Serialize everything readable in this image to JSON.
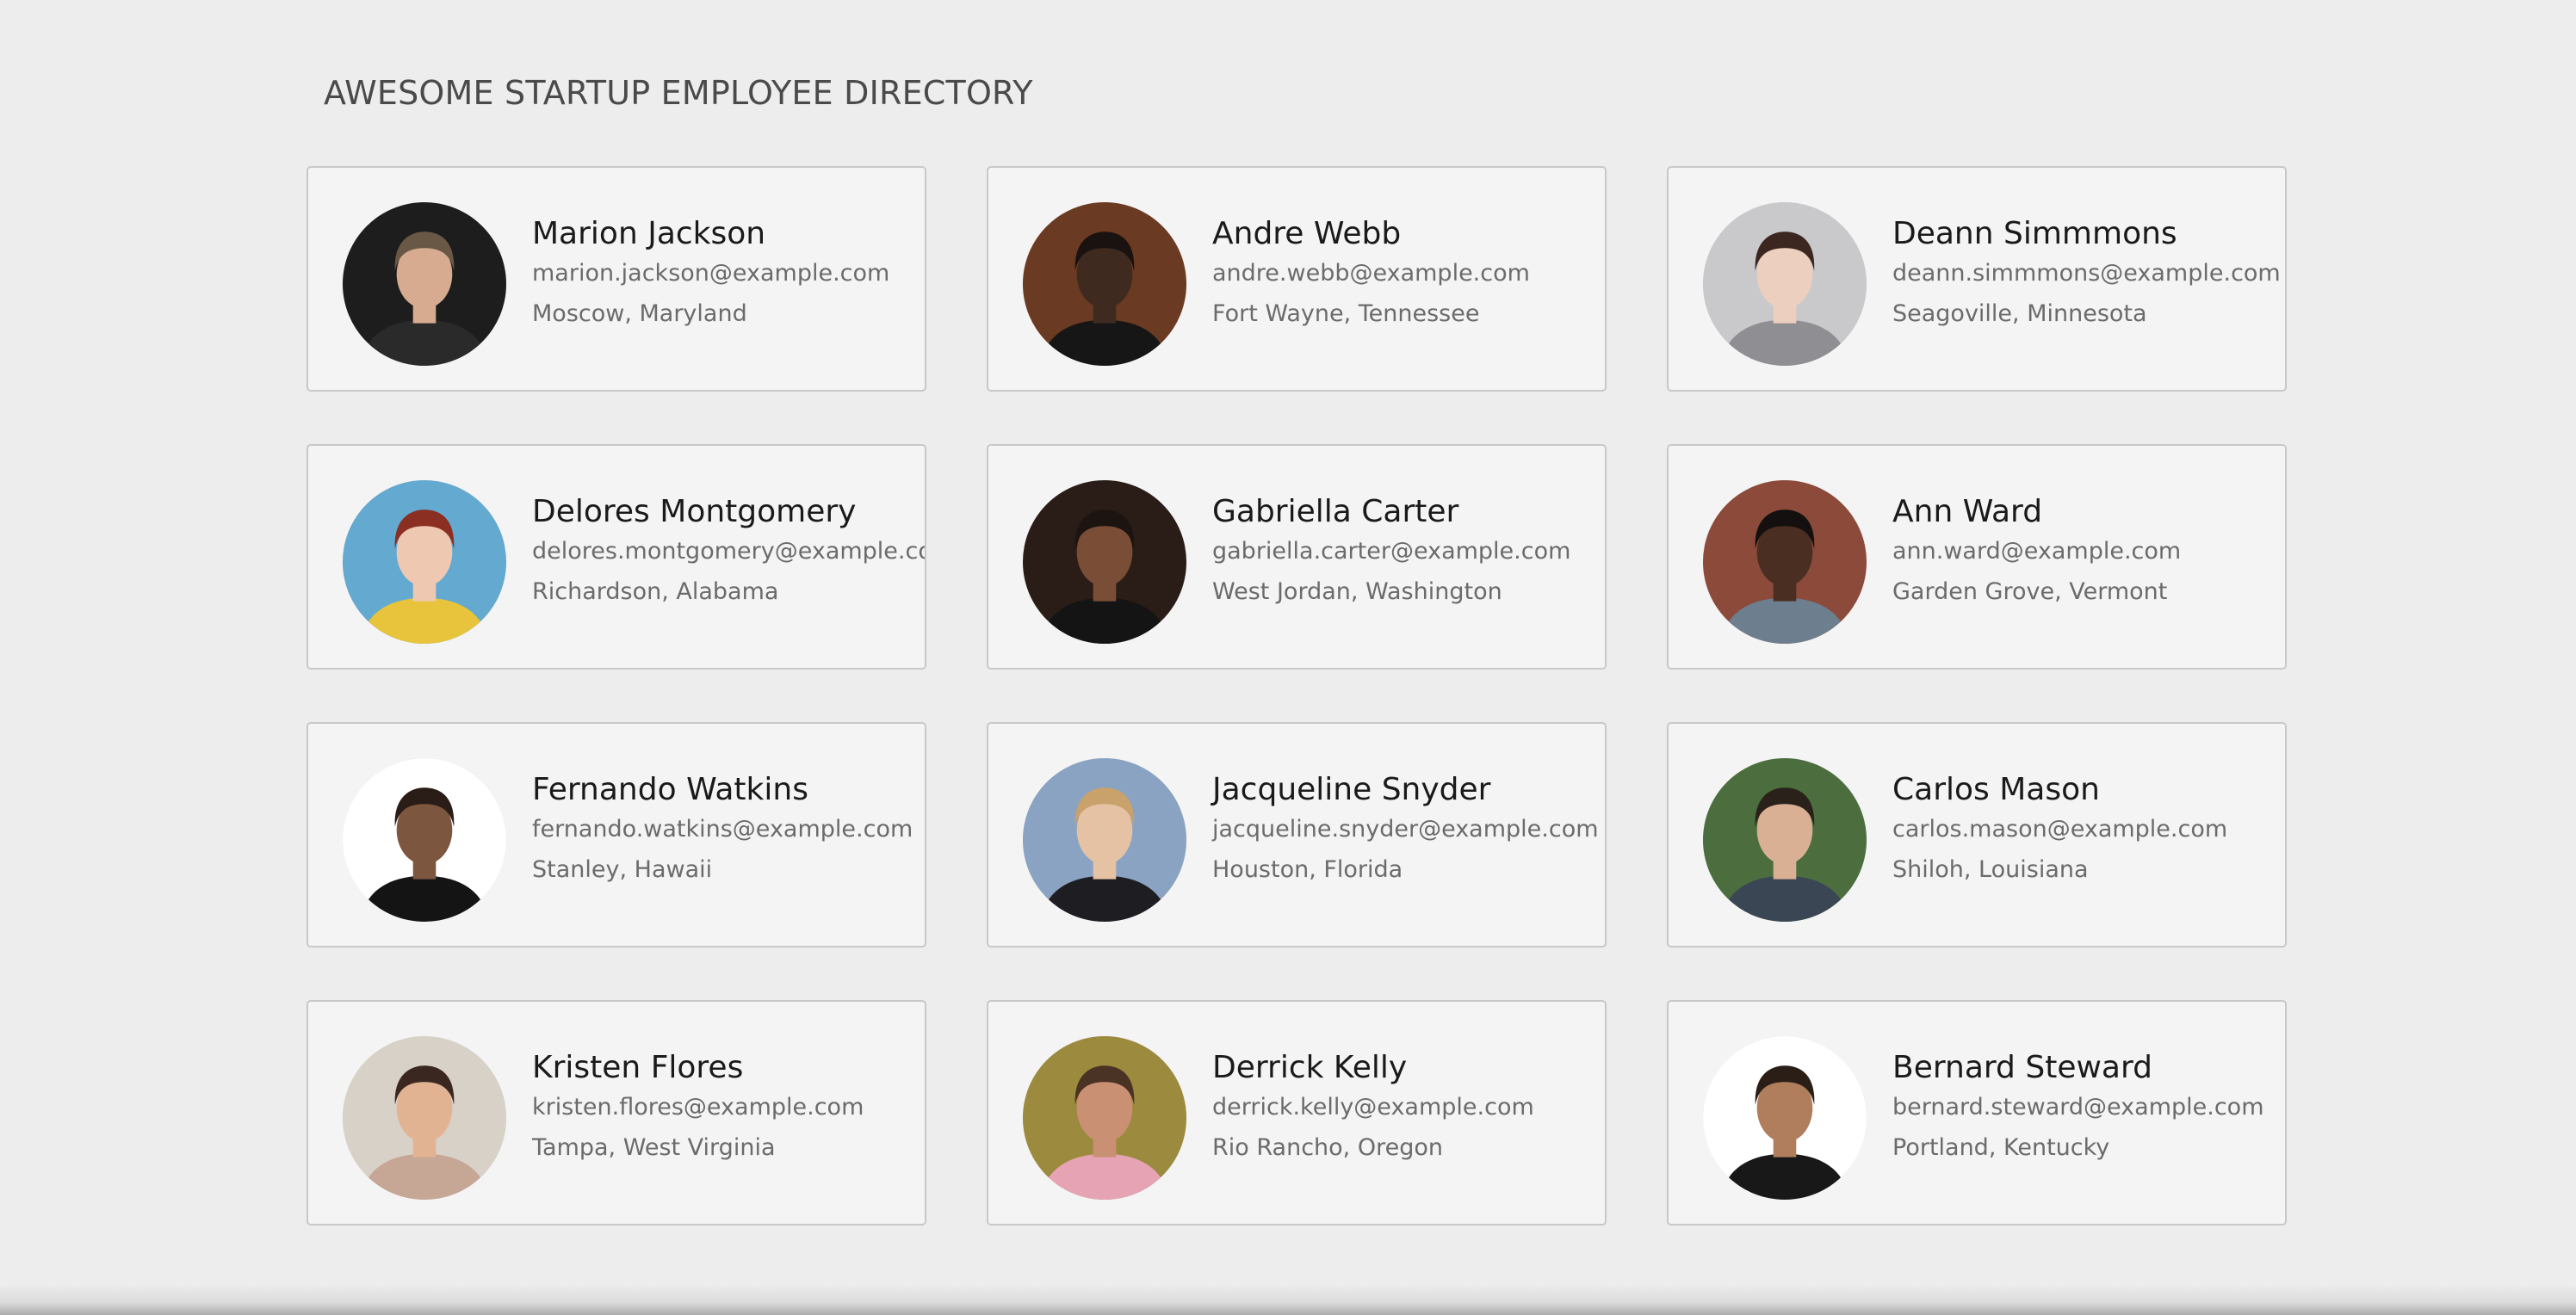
{
  "header": {
    "title": "AWESOME STARTUP EMPLOYEE DIRECTORY"
  },
  "employees": [
    {
      "name": "Marion Jackson",
      "email": "marion.jackson@example.com",
      "location": "Moscow, Maryland",
      "avatar": {
        "bg": "#1d1d1d",
        "skin": "#d6ab90",
        "hair": "#6a5846",
        "shirt": "#2a2a2a"
      }
    },
    {
      "name": "Andre Webb",
      "email": "andre.webb@example.com",
      "location": "Fort Wayne, Tennessee",
      "avatar": {
        "bg": "#6b3a22",
        "skin": "#3f2a20",
        "hair": "#1a1210",
        "shirt": "#161616"
      }
    },
    {
      "name": "Deann Simmmons",
      "email": "deann.simmmons@example.com",
      "location": "Seagoville, Minnesota",
      "avatar": {
        "bg": "#c9c9cc",
        "skin": "#edcfbf",
        "hair": "#3b2620",
        "shirt": "#8f8f93"
      }
    },
    {
      "name": "Delores Montgomery",
      "email": "delores.montgomery@example.com",
      "location": "Richardson, Alabama",
      "avatar": {
        "bg": "#63a9d0",
        "skin": "#efc8b2",
        "hair": "#8a2f22",
        "shirt": "#e7c43c"
      }
    },
    {
      "name": "Gabriella Carter",
      "email": "gabriella.carter@example.com",
      "location": "West Jordan, Washington",
      "avatar": {
        "bg": "#2a1d18",
        "skin": "#7a4d36",
        "hair": "#1c1410",
        "shirt": "#141414"
      }
    },
    {
      "name": "Ann Ward",
      "email": "ann.ward@example.com",
      "location": "Garden Grove, Vermont",
      "avatar": {
        "bg": "#8b4a3a",
        "skin": "#4a2e22",
        "hair": "#141010",
        "shirt": "#6d7f8f"
      }
    },
    {
      "name": "Fernando Watkins",
      "email": "fernando.watkins@example.com",
      "location": "Stanley, Hawaii",
      "avatar": {
        "bg": "#ffffff",
        "skin": "#7d5640",
        "hair": "#2a1d17",
        "shirt": "#141414"
      }
    },
    {
      "name": "Jacqueline Snyder",
      "email": "jacqueline.snyder@example.com",
      "location": "Houston, Florida",
      "avatar": {
        "bg": "#8aa3c2",
        "skin": "#e6c2a4",
        "hair": "#c9a26b",
        "shirt": "#1e1e22"
      }
    },
    {
      "name": "Carlos Mason",
      "email": "carlos.mason@example.com",
      "location": "Shiloh, Louisiana",
      "avatar": {
        "bg": "#4c6e3e",
        "skin": "#d9b093",
        "hair": "#2b211b",
        "shirt": "#3a4654"
      }
    },
    {
      "name": "Kristen Flores",
      "email": "kristen.flores@example.com",
      "location": "Tampa, West Virginia",
      "avatar": {
        "bg": "#d8d1c7",
        "skin": "#e2b393",
        "hair": "#3a2820",
        "shirt": "#c6a695"
      }
    },
    {
      "name": "Derrick Kelly",
      "email": "derrick.kelly@example.com",
      "location": "Rio Rancho, Oregon",
      "avatar": {
        "bg": "#9c8a3e",
        "skin": "#c99074",
        "hair": "#4a3324",
        "shirt": "#e6a3b4"
      }
    },
    {
      "name": "Bernard Steward",
      "email": "bernard.steward@example.com",
      "location": "Portland, Kentucky",
      "avatar": {
        "bg": "#ffffff",
        "skin": "#b07e5d",
        "hair": "#2a1e17",
        "shirt": "#181818"
      }
    }
  ]
}
